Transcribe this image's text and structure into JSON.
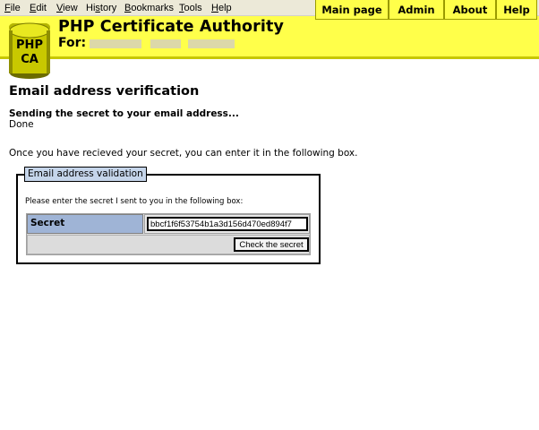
{
  "browser": {
    "menu": [
      {
        "key": "F",
        "rest": "ile"
      },
      {
        "key": "E",
        "rest": "dit"
      },
      {
        "key": "V",
        "rest": "iew"
      },
      {
        "key": "",
        "pre": "Hi",
        "ul": "s",
        "post": "tory"
      },
      {
        "key": "B",
        "rest": "ookmarks"
      },
      {
        "key": "T",
        "rest": "ools"
      },
      {
        "key": "H",
        "rest": "elp"
      }
    ]
  },
  "header": {
    "logo_text_top": "PHP",
    "logo_text_bottom": "CA",
    "title": "PHP Certificate Authority",
    "for_label": "For:",
    "nav": [
      "Main page",
      "Admin",
      "About",
      "Help"
    ],
    "colors": {
      "background": "#ffff4a",
      "border": "#c7c700"
    }
  },
  "main": {
    "title": "Email address verification",
    "sending": "Sending the secret to your email address...",
    "status": "Done",
    "instruction": "Once you have recieved your secret, you can enter it in the following box.",
    "form": {
      "legend": "Email address validation",
      "prompt": "Please enter the secret I sent to you in the following box:",
      "secret_label": "Secret",
      "secret_value": "bbcf1f6f53754b1a3d156d470ed894f7",
      "submit_label": "Check the secret",
      "colors": {
        "legend_bg": "#c5d5ea",
        "label_bg": "#9fb4d6"
      }
    }
  }
}
